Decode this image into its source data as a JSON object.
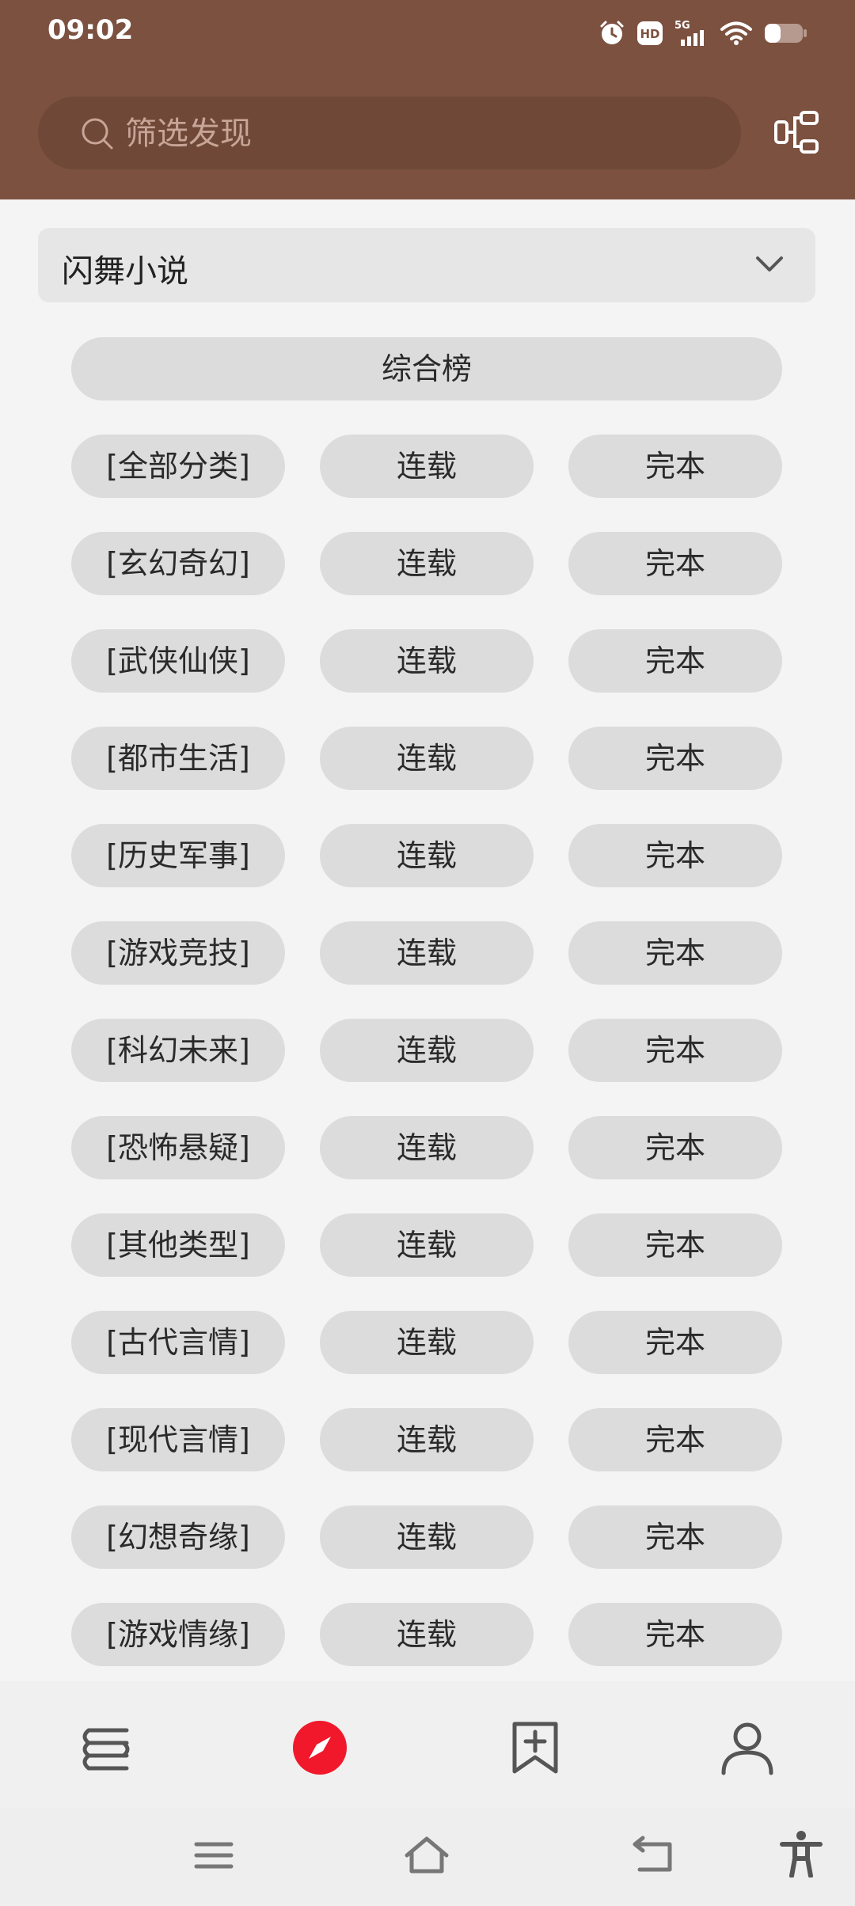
{
  "status_bar": {
    "time": "09:02",
    "network": "5G",
    "hd": "HD"
  },
  "search": {
    "placeholder": "筛选发现"
  },
  "source_select": {
    "selected": "闪舞小说"
  },
  "top_button": {
    "label": "综合榜"
  },
  "categories": [
    {
      "name": "[全部分类]",
      "ongoing": "连载",
      "completed": "完本"
    },
    {
      "name": "[玄幻奇幻]",
      "ongoing": "连载",
      "completed": "完本"
    },
    {
      "name": "[武侠仙侠]",
      "ongoing": "连载",
      "completed": "完本"
    },
    {
      "name": "[都市生活]",
      "ongoing": "连载",
      "completed": "完本"
    },
    {
      "name": "[历史军事]",
      "ongoing": "连载",
      "completed": "完本"
    },
    {
      "name": "[游戏竞技]",
      "ongoing": "连载",
      "completed": "完本"
    },
    {
      "name": "[科幻未来]",
      "ongoing": "连载",
      "completed": "完本"
    },
    {
      "name": "[恐怖悬疑]",
      "ongoing": "连载",
      "completed": "完本"
    },
    {
      "name": "[其他类型]",
      "ongoing": "连载",
      "completed": "完本"
    },
    {
      "name": "[古代言情]",
      "ongoing": "连载",
      "completed": "完本"
    },
    {
      "name": "[现代言情]",
      "ongoing": "连载",
      "completed": "完本"
    },
    {
      "name": "[幻想奇缘]",
      "ongoing": "连载",
      "completed": "完本"
    },
    {
      "name": "[游戏情缘]",
      "ongoing": "连载",
      "completed": "完本"
    }
  ],
  "bottom_nav": {
    "items": [
      {
        "icon": "bookshelf-icon",
        "active": false
      },
      {
        "icon": "discover-compass-icon",
        "active": true
      },
      {
        "icon": "bookmark-add-icon",
        "active": false
      },
      {
        "icon": "profile-icon",
        "active": false
      }
    ]
  },
  "colors": {
    "header": "#7c5140",
    "search_bg": "#6f4838",
    "pill_bg": "#dcdcdc",
    "active_accent": "#f0182a"
  }
}
